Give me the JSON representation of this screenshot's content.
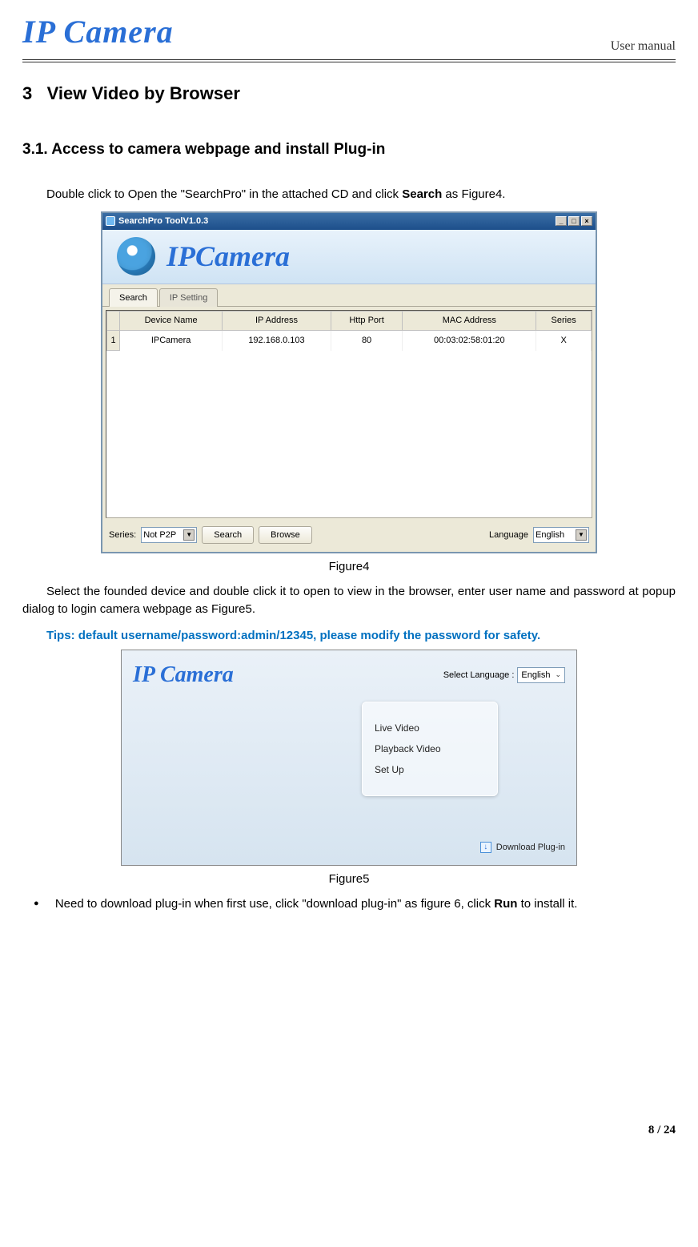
{
  "header": {
    "logo_text": "IP Camera",
    "right_text": "User manual"
  },
  "section3": {
    "num": "3",
    "title": "View Video by Browser"
  },
  "section31": {
    "num": "3.1.",
    "title": "Access to camera webpage and install Plug-in"
  },
  "para1_a": "Double click to Open the \"SearchPro\" in the attached CD and click ",
  "para1_b": "Search",
  "para1_c": " as Figure4.",
  "fig4": {
    "caption": "Figure4",
    "title": "SearchPro ToolV1.0.3",
    "banner_logo": "IPCamera",
    "tab_search": "Search",
    "tab_ipsetting": "IP Setting",
    "cols": {
      "c0": "",
      "c1": "Device Name",
      "c2": "IP Address",
      "c3": "Http Port",
      "c4": "MAC Address",
      "c5": "Series"
    },
    "row": {
      "idx": "1",
      "c1": "IPCamera",
      "c2": "192.168.0.103",
      "c3": "80",
      "c4": "00:03:02:58:01:20",
      "c5": "X"
    },
    "lbl_series": "Series:",
    "sel_series": "Not P2P",
    "btn_search": "Search",
    "btn_browse": "Browse",
    "lbl_language": "Language",
    "sel_language": "English"
  },
  "para2": "Select the founded device and double click it to open to view in the browser, enter user name and password at popup dialog to login camera webpage as Figure5.",
  "tips": "Tips: default username/password:admin/12345, please modify the password for safety.",
  "fig5": {
    "caption": "Figure5",
    "logo": "IP Camera",
    "lang_label": "Select Language :",
    "lang_value": "English",
    "m1": "Live Video",
    "m2": "Playback Video",
    "m3": "Set Up",
    "download": "Download Plug-in"
  },
  "bullet1_a": "Need to download plug-in when first use, click \"download plug-in\" as figure 6, click ",
  "bullet1_b": "Run",
  "bullet1_c": " to install it.",
  "footer": "8 / 24"
}
